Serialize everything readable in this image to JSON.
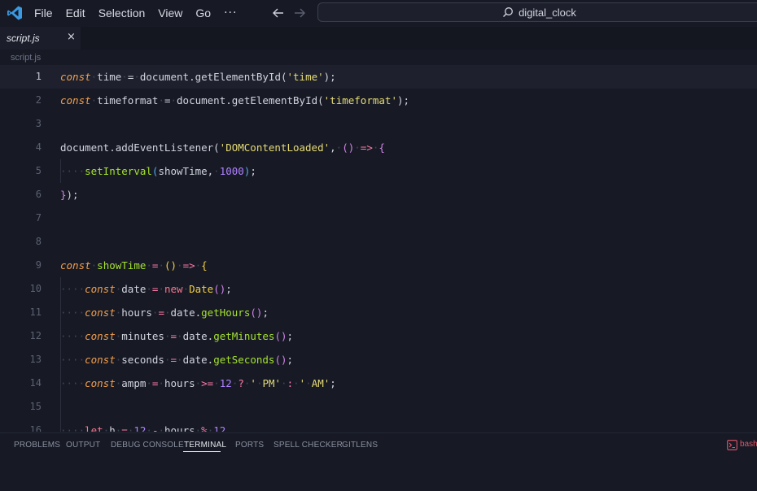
{
  "menu": [
    "File",
    "Edit",
    "Selection",
    "View",
    "Go"
  ],
  "menu_more": "···",
  "search": {
    "text": "digital_clock"
  },
  "tab": {
    "label": "script.js",
    "close": "×"
  },
  "breadcrumb": "script.js",
  "current_line": 1,
  "code_lines": [
    {
      "num": "1",
      "html": "<span class=\"k\">const</span><span class=\"d\">·</span>time<span class=\"d\">·</span>=<span class=\"d\">·</span>document.getElementById(<span class=\"s\">'time'</span>);"
    },
    {
      "num": "2",
      "html": "<span class=\"k\">const</span><span class=\"d\">·</span>timeformat<span class=\"d\">·</span>=<span class=\"d\">·</span>document.getElementById(<span class=\"s\">'timeformat'</span>);"
    },
    {
      "num": "3",
      "html": ""
    },
    {
      "num": "4",
      "html": "document.addEventListener(<span class=\"s\">'DOMContentLoaded'</span>,<span class=\"d\">·</span><span class=\"pr\">()</span><span class=\"d\">·</span><span class=\"o\">=&gt;</span><span class=\"d\">·</span><span class=\"pr\">{</span>"
    },
    {
      "num": "5",
      "html": "<span class=\"d\">····</span><span class=\"f\">setInterval</span><span class=\"b\">(</span>showTime,<span class=\"d\">·</span><span class=\"num\">1000</span><span class=\"b\">)</span>;"
    },
    {
      "num": "6",
      "html": "<span class=\"pr\">}</span>);"
    },
    {
      "num": "7",
      "html": ""
    },
    {
      "num": "8",
      "html": ""
    },
    {
      "num": "9",
      "html": "<span class=\"k\">const</span><span class=\"d\">·</span><span class=\"f\">showTime</span><span class=\"d\">·</span><span class=\"o\">=</span><span class=\"d\">·</span><span class=\"p\">()</span><span class=\"d\">·</span><span class=\"o\">=&gt;</span><span class=\"d\">·</span><span class=\"p\">{</span>"
    },
    {
      "num": "10",
      "html": "<span class=\"d\">····</span><span class=\"k\">const</span><span class=\"d\">·</span>date<span class=\"d\">·</span><span class=\"o\">=</span><span class=\"d\">·</span><span class=\"n\">new</span><span class=\"d\">·</span><span class=\"p\">Date</span><span class=\"pr\">()</span>;"
    },
    {
      "num": "11",
      "html": "<span class=\"d\">····</span><span class=\"k\">const</span><span class=\"d\">·</span>hours<span class=\"d\">·</span><span class=\"o\">=</span><span class=\"d\">·</span>date.<span class=\"f\">getHours</span><span class=\"pr\">()</span>;"
    },
    {
      "num": "12",
      "html": "<span class=\"d\">····</span><span class=\"k\">const</span><span class=\"d\">·</span>minutes<span class=\"d\">·</span><span class=\"o\">=</span><span class=\"d\">·</span>date.<span class=\"f\">getMinutes</span><span class=\"pr\">()</span>;"
    },
    {
      "num": "13",
      "html": "<span class=\"d\">····</span><span class=\"k\">const</span><span class=\"d\">·</span>seconds<span class=\"d\">·</span><span class=\"o\">=</span><span class=\"d\">·</span>date.<span class=\"f\">getSeconds</span><span class=\"pr\">()</span>;"
    },
    {
      "num": "14",
      "html": "<span class=\"d\">····</span><span class=\"k\">const</span><span class=\"d\">·</span>ampm<span class=\"d\">·</span><span class=\"o\">=</span><span class=\"d\">·</span>hours<span class=\"d\">·</span><span class=\"o\">&gt;=</span><span class=\"d\">·</span><span class=\"num\">12</span><span class=\"d\">·</span><span class=\"o\">?</span><span class=\"d\">·</span><span class=\"s\">'</span><span class=\"d\">·</span><span class=\"s\">PM'</span><span class=\"d\">·</span><span class=\"o\">:</span><span class=\"d\">·</span><span class=\"s\">'</span><span class=\"d\">·</span><span class=\"s\">AM'</span>;"
    },
    {
      "num": "15",
      "html": ""
    },
    {
      "num": "16",
      "html": "<span class=\"d\">····</span><span class=\"n\">let</span><span class=\"d\">·</span>h<span class=\"d\">·</span><span class=\"o\">=</span><span class=\"d\">·</span><span class=\"num\">12</span><span class=\"d\">·</span><span class=\"o\">-</span><span class=\"d\">·</span>hours<span class=\"d\">·</span><span class=\"o\">%</span><span class=\"d\">·</span><span class=\"num\">12</span>"
    }
  ],
  "panel_tabs": [
    "PROBLEMS",
    "OUTPUT",
    "DEBUG CONSOLE",
    "TERMINAL",
    "PORTS",
    "SPELL CHECKER",
    "GITLENS"
  ],
  "active_panel_tab": "TERMINAL",
  "terminal_label": "bash",
  "colors": {
    "accent_blue": "#3b9ae1",
    "terminal_red": "#e0566b",
    "keyword": "#f29e4c"
  }
}
